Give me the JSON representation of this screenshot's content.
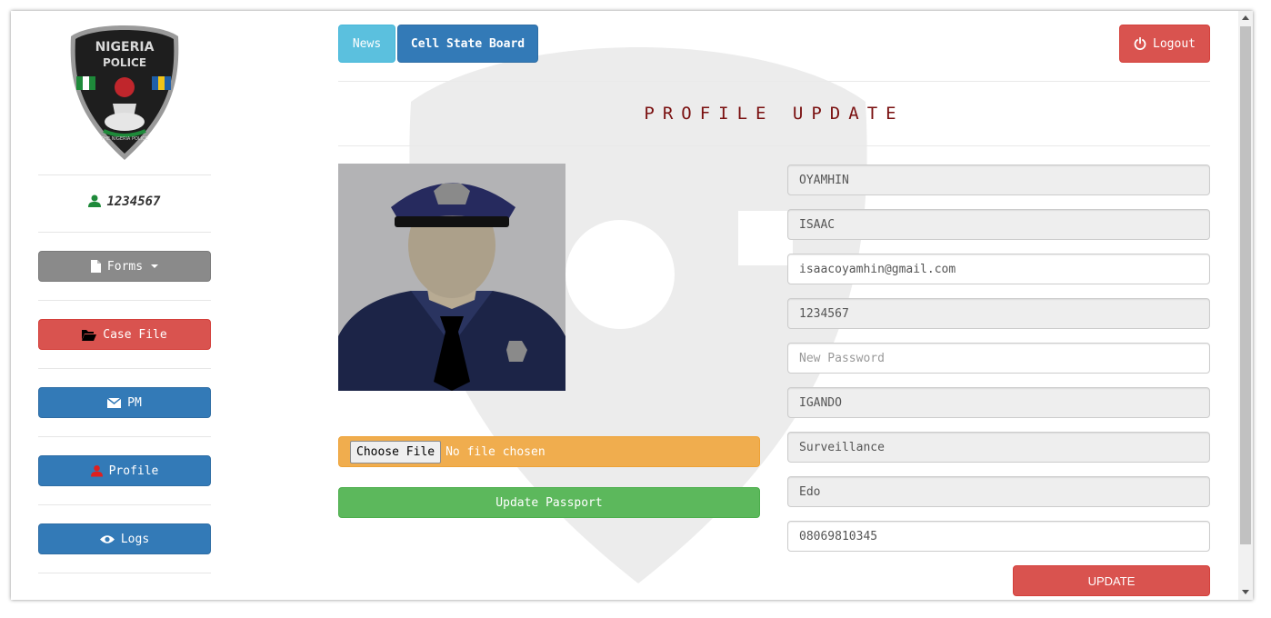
{
  "sidebar": {
    "logo": {
      "line1": "NIGERIA",
      "line2": "POLICE",
      "ribbon": "THE NIGERIA POLICE"
    },
    "user_id": "1234567",
    "buttons": [
      {
        "label": "Forms",
        "icon": "file-icon",
        "color": "#8a8a8a"
      },
      {
        "label": "Case File",
        "icon": "folder-open-icon",
        "color": "#d9534f"
      },
      {
        "label": "PM",
        "icon": "envelope-icon",
        "color": "#337ab7"
      },
      {
        "label": "Profile",
        "icon": "user-icon",
        "color": "#337ab7"
      },
      {
        "label": "Logs",
        "icon": "eye-icon",
        "color": "#337ab7"
      }
    ]
  },
  "nav": {
    "news": "News",
    "cell_state_board": "Cell State Board",
    "logout": "Logout"
  },
  "page_title": "PROFILE UPDATE",
  "passport": {
    "choose_file": "Choose File",
    "no_file": "No file chosen",
    "update_label": "Update Passport"
  },
  "form": {
    "surname": "OYAMHIN",
    "first_name": "ISAAC",
    "email": "isaacoyamhin@gmail.com",
    "id_number": "1234567",
    "password_placeholder": "New Password",
    "station": "IGANDO",
    "department": "Surveillance",
    "state": "Edo",
    "phone": "08069810345",
    "submit_label": "UPDATE"
  },
  "colors": {
    "title": "#7a1010",
    "primary": "#337ab7",
    "danger": "#d9534f",
    "success": "#5cb85c",
    "warning": "#f0ad4e",
    "info": "#5bc0de"
  }
}
